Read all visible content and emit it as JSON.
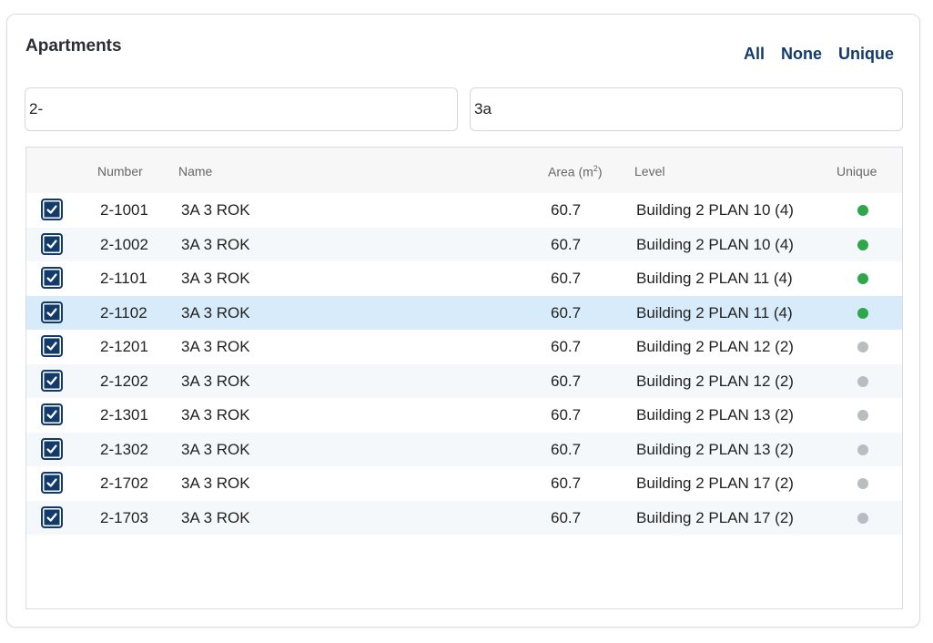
{
  "panel": {
    "title": "Apartments",
    "actions": {
      "all": "All",
      "none": "None",
      "unique": "Unique"
    }
  },
  "filters": {
    "number": "2-",
    "name": "3a"
  },
  "table": {
    "headers": {
      "number": "Number",
      "name": "Name",
      "area": "Area (m",
      "area_sup": "2",
      "area_close": ")",
      "level": "Level",
      "unique": "Unique"
    },
    "rows": [
      {
        "checked": true,
        "number": "2-1001",
        "name": "3A 3 ROK",
        "area": "60.7",
        "level": "Building 2 PLAN 10 (4)",
        "unique": true
      },
      {
        "checked": true,
        "number": "2-1002",
        "name": "3A 3 ROK",
        "area": "60.7",
        "level": "Building 2 PLAN 10 (4)",
        "unique": true
      },
      {
        "checked": true,
        "number": "2-1101",
        "name": "3A 3 ROK",
        "area": "60.7",
        "level": "Building 2 PLAN 11 (4)",
        "unique": true
      },
      {
        "checked": true,
        "number": "2-1102",
        "name": "3A 3 ROK",
        "area": "60.7",
        "level": "Building 2 PLAN 11 (4)",
        "unique": true,
        "selected": true
      },
      {
        "checked": true,
        "number": "2-1201",
        "name": "3A 3 ROK",
        "area": "60.7",
        "level": "Building 2 PLAN 12 (2)",
        "unique": false
      },
      {
        "checked": true,
        "number": "2-1202",
        "name": "3A 3 ROK",
        "area": "60.7",
        "level": "Building 2 PLAN 12 (2)",
        "unique": false
      },
      {
        "checked": true,
        "number": "2-1301",
        "name": "3A 3 ROK",
        "area": "60.7",
        "level": "Building 2 PLAN 13 (2)",
        "unique": false
      },
      {
        "checked": true,
        "number": "2-1302",
        "name": "3A 3 ROK",
        "area": "60.7",
        "level": "Building 2 PLAN 13 (2)",
        "unique": false
      },
      {
        "checked": true,
        "number": "2-1702",
        "name": "3A 3 ROK",
        "area": "60.7",
        "level": "Building 2 PLAN 17 (2)",
        "unique": false
      },
      {
        "checked": true,
        "number": "2-1703",
        "name": "3A 3 ROK",
        "area": "60.7",
        "level": "Building 2 PLAN 17 (2)",
        "unique": false
      }
    ]
  },
  "colors": {
    "accent": "#123b6b",
    "unique_on": "#2ea64a",
    "unique_off": "#b9bcc0",
    "selected_row": "#d7ebfb"
  }
}
